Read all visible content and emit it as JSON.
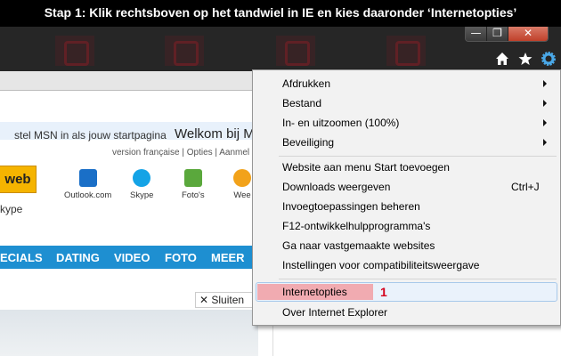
{
  "banner": {
    "text": "Stap 1: Klik rechtsboven op het tandwiel in IE en kies daaronder ‘Internetopties’"
  },
  "window": {
    "minimize": "—",
    "maximize": "❐",
    "close": "✕"
  },
  "toolbar": {
    "home_icon": "home-icon",
    "favorites_icon": "star-icon",
    "tools_icon": "gear-icon"
  },
  "msn": {
    "set_home": "stel MSN in als jouw startpagina",
    "welcome": "Welkom bij MS",
    "links": "version française | Opties | Aanmel",
    "web_button": "web",
    "skype_left": "kype",
    "services": [
      {
        "label": "Outlook.com",
        "icon": "outlook-icon",
        "color": "#1a6fc7"
      },
      {
        "label": "Skype",
        "icon": "skype-icon",
        "color": "#14a3e6"
      },
      {
        "label": "Foto's",
        "icon": "photos-icon",
        "color": "#5aa83c"
      },
      {
        "label": "Wee",
        "icon": "weather-icon",
        "color": "#f2a21a"
      }
    ],
    "nav": [
      "ECIALS",
      "DATING",
      "VIDEO",
      "FOTO",
      "MEER"
    ],
    "close_label": "✕ Sluiten"
  },
  "menu": {
    "groups": [
      {
        "label": "Afdrukken",
        "submenu": true
      },
      {
        "label": "Bestand",
        "submenu": true
      },
      {
        "label": "In- en uitzoomen (100%)",
        "submenu": true
      },
      {
        "label": "Beveiliging",
        "submenu": true
      }
    ],
    "items": [
      {
        "label": "Website aan menu Start toevoegen",
        "shortcut": ""
      },
      {
        "label": "Downloads weergeven",
        "shortcut": "Ctrl+J"
      },
      {
        "label": "Invoegtoepassingen beheren",
        "shortcut": ""
      },
      {
        "label": "F12-ontwikkelhulpprogramma's",
        "shortcut": ""
      },
      {
        "label": "Ga naar vastgemaakte websites",
        "shortcut": ""
      },
      {
        "label": "Instellingen voor compatibiliteitsweergave",
        "shortcut": ""
      }
    ],
    "internet_options": "Internetopties",
    "highlight_number": "1",
    "about": "Over Internet Explorer"
  }
}
